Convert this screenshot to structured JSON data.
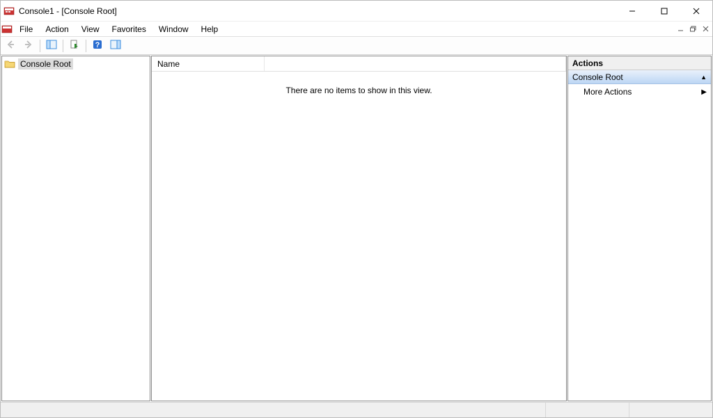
{
  "window": {
    "title": "Console1 - [Console Root]"
  },
  "menu": {
    "file": "File",
    "action": "Action",
    "view": "View",
    "favorites": "Favorites",
    "window": "Window",
    "help": "Help"
  },
  "tree": {
    "root_label": "Console Root"
  },
  "list": {
    "columns": {
      "name": "Name"
    },
    "empty_message": "There are no items to show in this view."
  },
  "actions": {
    "title": "Actions",
    "section": "Console Root",
    "more_actions": "More Actions"
  }
}
